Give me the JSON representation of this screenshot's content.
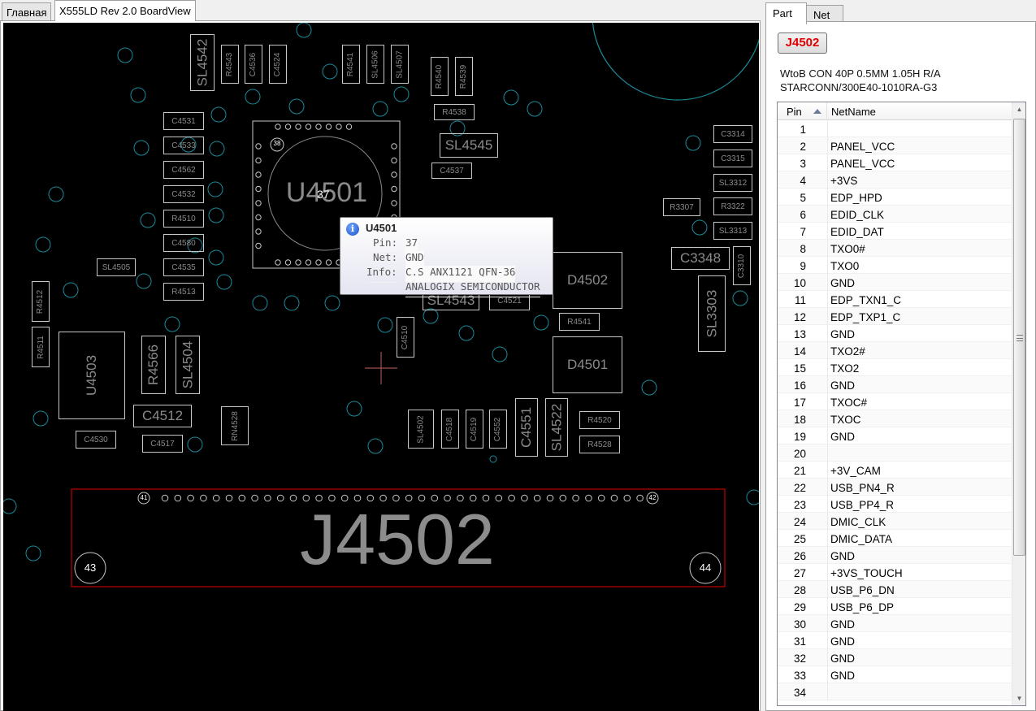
{
  "doc_tabs": [
    {
      "label": "Главная"
    },
    {
      "label": "X555LD Rev 2.0 BoardView"
    }
  ],
  "board": {
    "ic_main": {
      "ref": "U4501",
      "pin_hover": "37",
      "pin_first": "38"
    },
    "connector": {
      "ref": "J4502",
      "pin_left": "41",
      "pin_right": "42",
      "mount_left": "43",
      "mount_right": "44"
    },
    "components": [
      {
        "ref": "SL4542"
      },
      {
        "ref": "R4543"
      },
      {
        "ref": "C4536"
      },
      {
        "ref": "C4524"
      },
      {
        "ref": "R4541"
      },
      {
        "ref": "SL4506"
      },
      {
        "ref": "SL4507"
      },
      {
        "ref": "R4540"
      },
      {
        "ref": "R4539"
      },
      {
        "ref": "C4531"
      },
      {
        "ref": "C4533"
      },
      {
        "ref": "C4562"
      },
      {
        "ref": "C4532"
      },
      {
        "ref": "R4510"
      },
      {
        "ref": "C4580"
      },
      {
        "ref": "C4535"
      },
      {
        "ref": "R4513"
      },
      {
        "ref": "R4538"
      },
      {
        "ref": "SL4545"
      },
      {
        "ref": "C4537"
      },
      {
        "ref": "SL4505"
      },
      {
        "ref": "R4512"
      },
      {
        "ref": "R4511"
      },
      {
        "ref": "U4503"
      },
      {
        "ref": "R4566"
      },
      {
        "ref": "SL4504"
      },
      {
        "ref": "C4512"
      },
      {
        "ref": "C4530"
      },
      {
        "ref": "C4517"
      },
      {
        "ref": "RN4528"
      },
      {
        "ref": "SL4543"
      },
      {
        "ref": "C4521"
      },
      {
        "ref": "D4502"
      },
      {
        "ref": "R4541"
      },
      {
        "ref": "D4501"
      },
      {
        "ref": "C4510"
      },
      {
        "ref": "SL4502"
      },
      {
        "ref": "C4518"
      },
      {
        "ref": "C4519"
      },
      {
        "ref": "C4552"
      },
      {
        "ref": "C4551"
      },
      {
        "ref": "SL4522"
      },
      {
        "ref": "R4520"
      },
      {
        "ref": "R4528"
      },
      {
        "ref": "C3314"
      },
      {
        "ref": "C3315"
      },
      {
        "ref": "SL3312"
      },
      {
        "ref": "R3322"
      },
      {
        "ref": "R3307"
      },
      {
        "ref": "SL3313"
      },
      {
        "ref": "C3348"
      },
      {
        "ref": "C3310"
      },
      {
        "ref": "SL3303"
      }
    ]
  },
  "tooltip": {
    "title": "U4501",
    "pin_label": "Pin:",
    "pin_value": "37",
    "net_label": "Net:",
    "net_value": "GND",
    "info_label": "Info:",
    "info_line1": "C.S ANX1121 QFN-36",
    "info_line2": "ANALOGIX SEMICONDUCTOR"
  },
  "side_tabs": [
    {
      "label": "Part"
    },
    {
      "label": "Net"
    }
  ],
  "part": {
    "ref": "J4502",
    "desc_line1": "WtoB CON 40P 0.5MM 1.05H R/A",
    "desc_line2": "STARCONN/300E40-1010RA-G3"
  },
  "grid": {
    "col_pin": "Pin",
    "col_net": "NetName",
    "rows": [
      {
        "pin": "1",
        "net": ""
      },
      {
        "pin": "2",
        "net": "PANEL_VCC"
      },
      {
        "pin": "3",
        "net": "PANEL_VCC"
      },
      {
        "pin": "4",
        "net": "+3VS"
      },
      {
        "pin": "5",
        "net": "EDP_HPD"
      },
      {
        "pin": "6",
        "net": "EDID_CLK"
      },
      {
        "pin": "7",
        "net": "EDID_DAT"
      },
      {
        "pin": "8",
        "net": "TXO0#"
      },
      {
        "pin": "9",
        "net": "TXO0"
      },
      {
        "pin": "10",
        "net": "GND"
      },
      {
        "pin": "11",
        "net": "EDP_TXN1_C"
      },
      {
        "pin": "12",
        "net": "EDP_TXP1_C"
      },
      {
        "pin": "13",
        "net": "GND"
      },
      {
        "pin": "14",
        "net": "TXO2#"
      },
      {
        "pin": "15",
        "net": "TXO2"
      },
      {
        "pin": "16",
        "net": "GND"
      },
      {
        "pin": "17",
        "net": "TXOC#"
      },
      {
        "pin": "18",
        "net": "TXOC"
      },
      {
        "pin": "19",
        "net": "GND"
      },
      {
        "pin": "20",
        "net": ""
      },
      {
        "pin": "21",
        "net": "+3V_CAM"
      },
      {
        "pin": "22",
        "net": "USB_PN4_R"
      },
      {
        "pin": "23",
        "net": "USB_PP4_R"
      },
      {
        "pin": "24",
        "net": "DMIC_CLK"
      },
      {
        "pin": "25",
        "net": "DMIC_DATA"
      },
      {
        "pin": "26",
        "net": "GND"
      },
      {
        "pin": "27",
        "net": "+3VS_TOUCH"
      },
      {
        "pin": "28",
        "net": "USB_P6_DN"
      },
      {
        "pin": "29",
        "net": "USB_P6_DP"
      },
      {
        "pin": "30",
        "net": "GND"
      },
      {
        "pin": "31",
        "net": "GND"
      },
      {
        "pin": "32",
        "net": "GND"
      },
      {
        "pin": "33",
        "net": "GND"
      },
      {
        "pin": "34",
        "net": ""
      }
    ]
  },
  "colors": {
    "board_bg": "#000000",
    "outline": "#c8c8c8",
    "via": "#1b8a9a",
    "highlight": "#c00000",
    "part_ref": "#e00000"
  }
}
